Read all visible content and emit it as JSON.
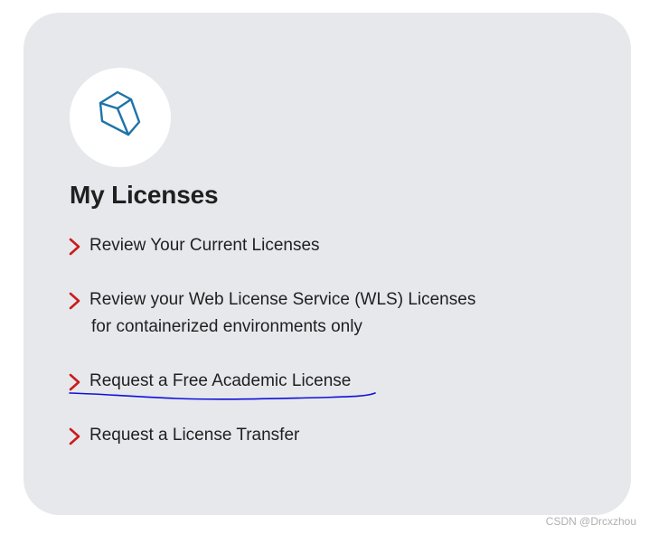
{
  "section": {
    "icon": "cube-icon",
    "title": "My Licenses"
  },
  "links": [
    {
      "line1": "Review Your Current Licenses",
      "line2": ""
    },
    {
      "line1": "Review your Web License Service (WLS) Licenses",
      "line2": "for containerized environments only"
    },
    {
      "line1": "Request a Free Academic License",
      "line2": ""
    },
    {
      "line1": "Request a License Transfer",
      "line2": ""
    }
  ],
  "colors": {
    "card_bg": "#e6e8ec",
    "chevron": "#cc1b1b",
    "icon_stroke": "#1e73a8",
    "annotation_ink": "#1010d8"
  },
  "watermark": "CSDN @Drcxzhou"
}
